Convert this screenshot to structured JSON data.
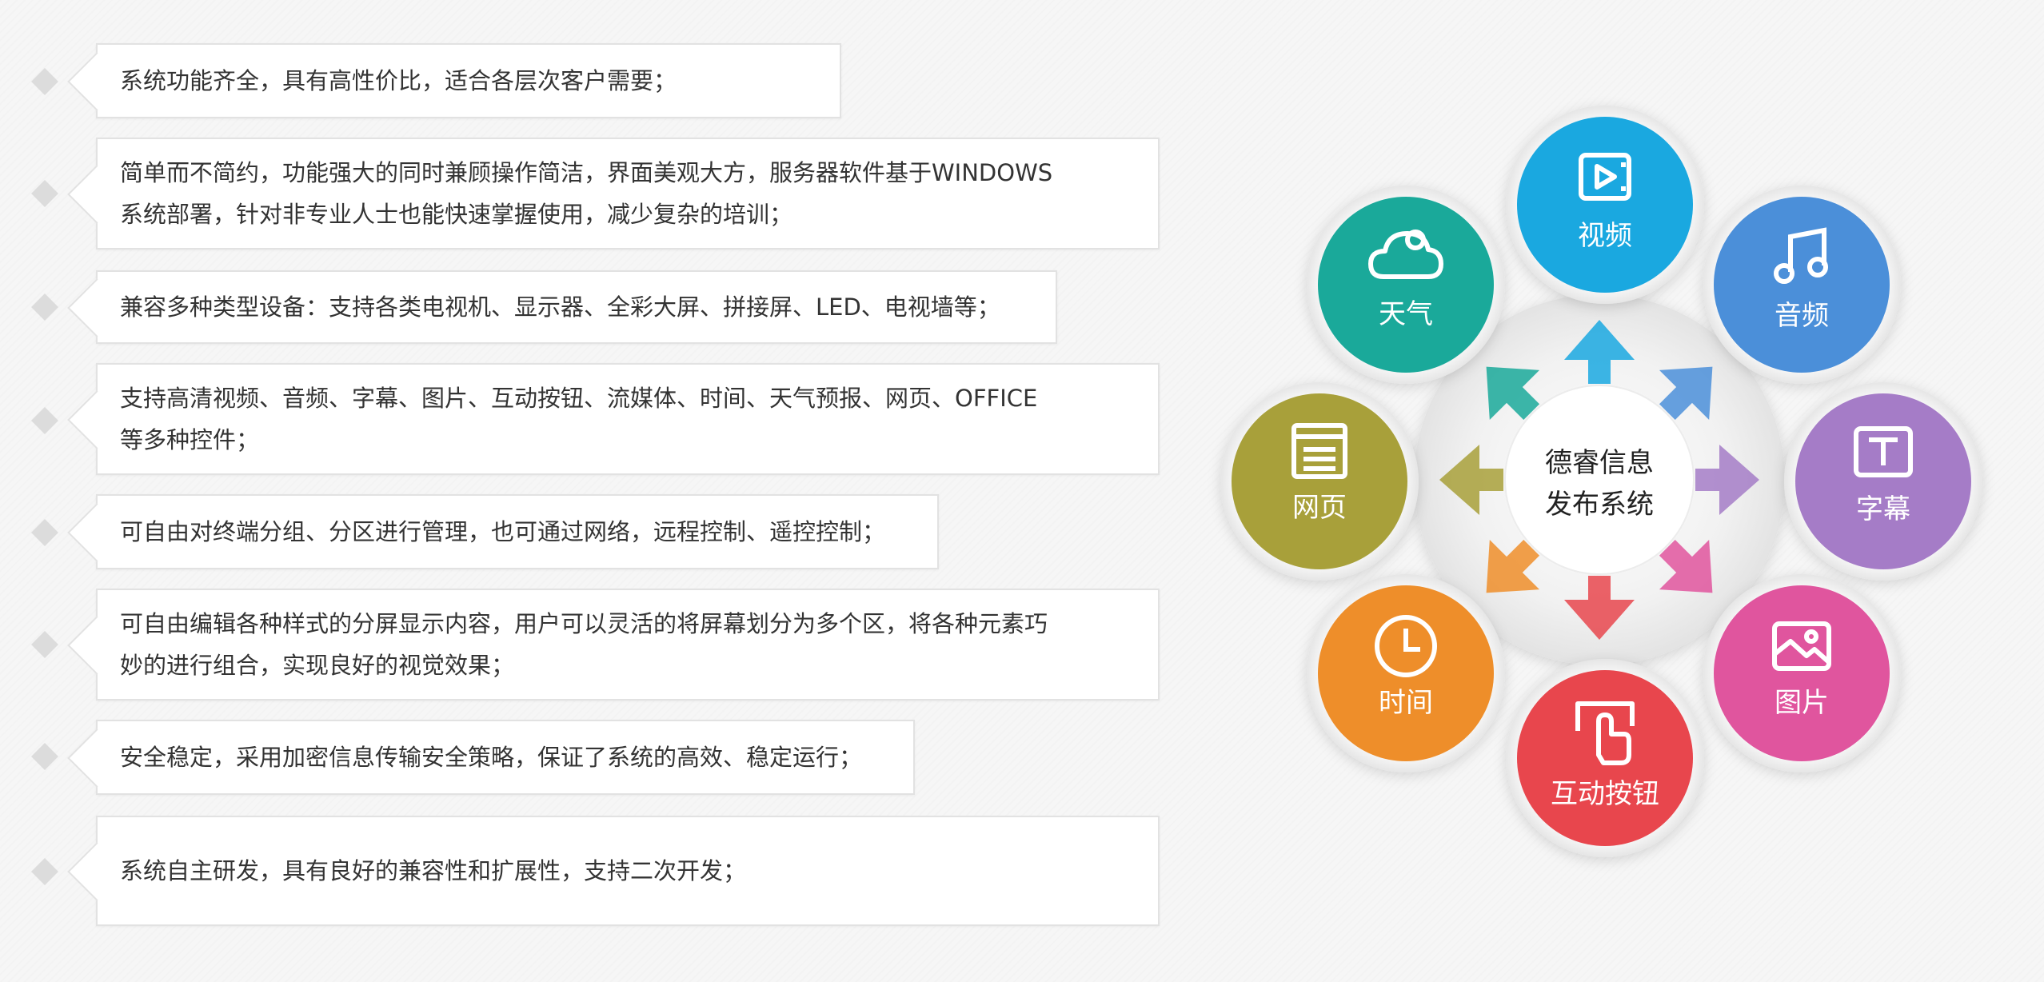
{
  "features": [
    {
      "text": "系统功能齐全，具有高性价比，适合各层次客户需要；"
    },
    {
      "text": "简单而不简约，功能强大的同时兼顾操作简洁，界面美观大方，服务器软件基于WINDOWS\n系统部署，针对非专业人士也能快速掌握使用，减少复杂的培训；"
    },
    {
      "text": "兼容多种类型设备：支持各类电视机、显示器、全彩大屏、拼接屏、LED、电视墙等；"
    },
    {
      "text": "支持高清视频、音频、字幕、图片、互动按钮、流媒体、时间、天气预报、网页、OFFICE\n等多种控件；"
    },
    {
      "text": "可自由对终端分组、分区进行管理，也可通过网络，远程控制、遥控控制；"
    },
    {
      "text": "可自由编辑各种样式的分屏显示内容，用户可以灵活的将屏幕划分为多个区，将各种元素巧\n妙的进行组合，实现良好的视觉效果；"
    },
    {
      "text": "安全稳定，采用加密信息传输安全策略，保证了系统的高效、稳定运行；"
    },
    {
      "text": "系统自主研发，具有良好的兼容性和扩展性，支持二次开发；"
    }
  ],
  "diagram": {
    "center_line1": "德睿信息",
    "center_line2": "发布系统",
    "nodes": [
      {
        "label": "视频",
        "icon": "video-icon",
        "color": "#1aa8e0"
      },
      {
        "label": "音频",
        "icon": "music-icon",
        "color": "#4b8fd9"
      },
      {
        "label": "字幕",
        "icon": "text-icon",
        "color": "#a57cc7"
      },
      {
        "label": "图片",
        "icon": "image-icon",
        "color": "#e0559e"
      },
      {
        "label": "互动按钮",
        "icon": "touch-icon",
        "color": "#e8464d"
      },
      {
        "label": "时间",
        "icon": "clock-icon",
        "color": "#ee8e2a"
      },
      {
        "label": "网页",
        "icon": "webpage-icon",
        "color": "#a8a03a"
      },
      {
        "label": "天气",
        "icon": "cloud-icon",
        "color": "#1aa99a"
      }
    ]
  }
}
